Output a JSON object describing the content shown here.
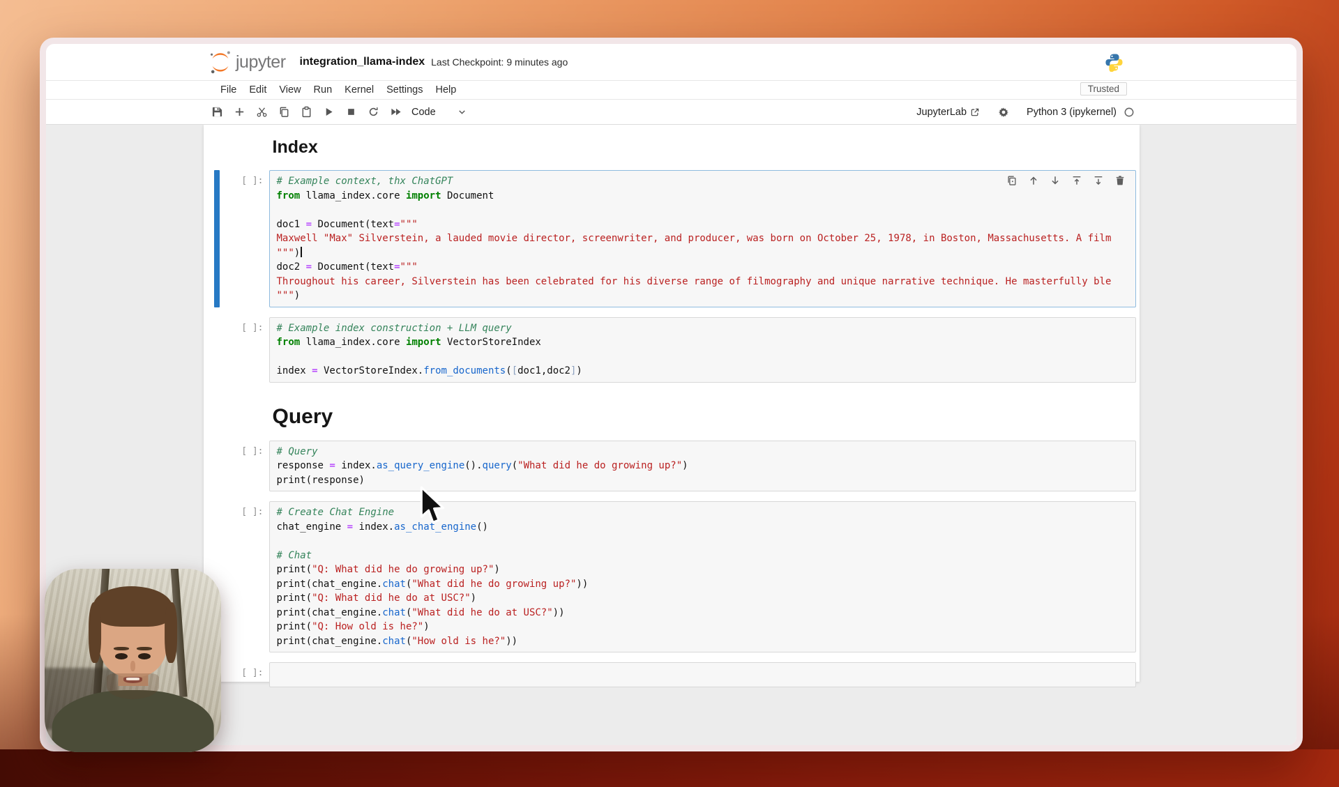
{
  "window": {
    "title_bar": {
      "brand": "jupyter",
      "filename": "integration_llama-index",
      "checkpoint": "Last Checkpoint: 9 minutes ago",
      "logo_icons": [
        "jupyter-logo",
        "python-logo"
      ]
    },
    "menu": {
      "items": [
        "File",
        "Edit",
        "View",
        "Run",
        "Kernel",
        "Settings",
        "Help"
      ],
      "trusted_badge": "Trusted"
    },
    "toolbar": {
      "left_icons": [
        "save",
        "add",
        "cut",
        "copy",
        "paste",
        "run",
        "stop",
        "restart",
        "run-all"
      ],
      "cell_type": "Code",
      "right": {
        "jupyterlab_link": "JupyterLab",
        "right_icons": [
          "external-link",
          "gear",
          "kernel-circle"
        ],
        "kernel_name": "Python 3 (ipykernel)"
      }
    }
  },
  "notebook": {
    "cell_toolbar_icons": [
      "duplicate",
      "move-up",
      "move-down",
      "insert-above",
      "insert-below",
      "trash"
    ],
    "cells": [
      {
        "type": "heading",
        "level": 2,
        "text": "Index"
      },
      {
        "type": "code",
        "selected": true,
        "show_toolbar": true,
        "prompt": "[ ]:",
        "lines": [
          [
            {
              "s": "cm",
              "t": "# Example context, thx ChatGPT"
            }
          ],
          [
            {
              "s": "kw",
              "t": "from"
            },
            {
              "t": " llama_index.core "
            },
            {
              "s": "kw",
              "t": "import"
            },
            {
              "t": " Document"
            }
          ],
          [],
          [
            {
              "t": "doc1 "
            },
            {
              "s": "op",
              "t": "="
            },
            {
              "t": " Document(text"
            },
            {
              "s": "op",
              "t": "="
            },
            {
              "s": "str",
              "t": "\"\"\""
            }
          ],
          [
            {
              "s": "str",
              "t": "Maxwell \"Max\" Silverstein, a lauded movie director, screenwriter, and producer, was born on October 25, 1978, in Boston, Massachusetts. A film"
            }
          ],
          [
            {
              "s": "str",
              "t": "\"\"\""
            },
            {
              "t": ")"
            },
            {
              "s": "caret"
            }
          ],
          [
            {
              "t": "doc2 "
            },
            {
              "s": "op",
              "t": "="
            },
            {
              "t": " Document(text"
            },
            {
              "s": "op",
              "t": "="
            },
            {
              "s": "str",
              "t": "\"\"\""
            }
          ],
          [
            {
              "s": "str",
              "t": "Throughout his career, Silverstein has been celebrated for his diverse range of filmography and unique narrative technique. He masterfully ble"
            }
          ],
          [
            {
              "s": "str",
              "t": "\"\"\""
            },
            {
              "t": ")"
            }
          ]
        ]
      },
      {
        "type": "code",
        "prompt": "[ ]:",
        "lines": [
          [
            {
              "s": "cm",
              "t": "# Example index construction + LLM query"
            }
          ],
          [
            {
              "s": "kw",
              "t": "from"
            },
            {
              "t": " llama_index.core "
            },
            {
              "s": "kw",
              "t": "import"
            },
            {
              "t": " VectorStoreIndex"
            }
          ],
          [],
          [
            {
              "t": "index "
            },
            {
              "s": "op",
              "t": "="
            },
            {
              "t": " VectorStoreIndex."
            },
            {
              "s": "fn",
              "t": "from_documents"
            },
            {
              "t": "("
            },
            {
              "s": "br",
              "t": "["
            },
            {
              "t": "doc1,doc2"
            },
            {
              "s": "br",
              "t": "]"
            },
            {
              "t": ")"
            }
          ]
        ]
      },
      {
        "type": "heading",
        "level": 1,
        "text": "Query"
      },
      {
        "type": "code",
        "prompt": "[ ]:",
        "lines": [
          [
            {
              "s": "cm",
              "t": "# Query"
            }
          ],
          [
            {
              "t": "response "
            },
            {
              "s": "op",
              "t": "="
            },
            {
              "t": " index."
            },
            {
              "s": "fn",
              "t": "as_query_engine"
            },
            {
              "t": "()."
            },
            {
              "s": "fn",
              "t": "query"
            },
            {
              "t": "("
            },
            {
              "s": "str",
              "t": "\"What did he do growing up?\""
            },
            {
              "t": ")"
            }
          ],
          [
            {
              "t": "print(response)"
            }
          ]
        ]
      },
      {
        "type": "code",
        "prompt": "[ ]:",
        "lines": [
          [
            {
              "s": "cm",
              "t": "# Create Chat Engine"
            }
          ],
          [
            {
              "t": "chat_engine "
            },
            {
              "s": "op",
              "t": "="
            },
            {
              "t": " index."
            },
            {
              "s": "fn",
              "t": "as_chat_engine"
            },
            {
              "t": "()"
            }
          ],
          [],
          [
            {
              "s": "cm",
              "t": "# Chat"
            }
          ],
          [
            {
              "t": "print("
            },
            {
              "s": "str",
              "t": "\"Q: What did he do growing up?\""
            },
            {
              "t": ")"
            }
          ],
          [
            {
              "t": "print(chat_engine."
            },
            {
              "s": "fn",
              "t": "chat"
            },
            {
              "t": "("
            },
            {
              "s": "str",
              "t": "\"What did he do growing up?\""
            },
            {
              "t": "))"
            }
          ],
          [
            {
              "t": "print("
            },
            {
              "s": "str",
              "t": "\"Q: What did he do at USC?\""
            },
            {
              "t": ")"
            }
          ],
          [
            {
              "t": "print(chat_engine."
            },
            {
              "s": "fn",
              "t": "chat"
            },
            {
              "t": "("
            },
            {
              "s": "str",
              "t": "\"What did he do at USC?\""
            },
            {
              "t": "))"
            }
          ],
          [
            {
              "t": "print("
            },
            {
              "s": "str",
              "t": "\"Q: How old is he?\""
            },
            {
              "t": ")"
            }
          ],
          [
            {
              "t": "print(chat_engine."
            },
            {
              "s": "fn",
              "t": "chat"
            },
            {
              "t": "("
            },
            {
              "s": "str",
              "t": "\"How old is he?\""
            },
            {
              "t": "))"
            }
          ]
        ]
      },
      {
        "type": "code",
        "empty": true,
        "prompt": "[ ]:",
        "lines": [
          []
        ]
      }
    ]
  },
  "overlays": {
    "webcam": "presenter-webcam",
    "mouse_cursor": "arrow-pointer"
  },
  "colors": {
    "jupyter_orange": "#f37726",
    "selection_blue": "#2779c4",
    "selected_cell_border": "#8fbbdf",
    "cell_bg": "#f7f7f7",
    "comment_green": "#35845b",
    "keyword_green": "#008000",
    "string_red": "#ba2121",
    "operator_purple": "#aa22ff",
    "function_blue": "#1766cc",
    "wallpaper_top": "#f4bd92",
    "wallpaper_bottom": "#6e1408"
  }
}
